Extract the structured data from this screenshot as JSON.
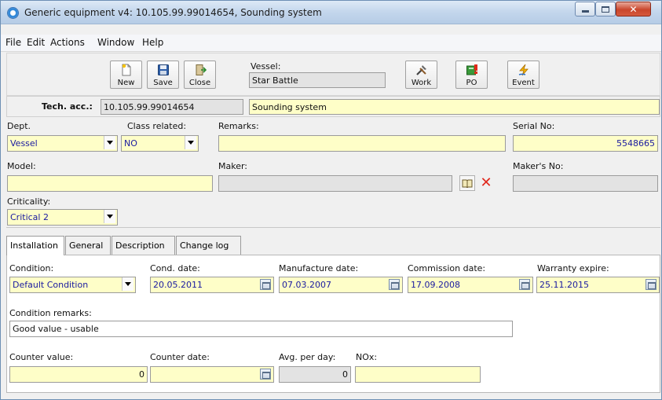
{
  "window": {
    "title": "Generic equipment v4: 10.105.99.99014654, Sounding system",
    "min_icon": "minimize-icon",
    "max_icon": "maximize-icon",
    "close_icon": "close-icon"
  },
  "menu": {
    "items": [
      "File",
      "Edit",
      "Actions",
      "Window",
      "Help"
    ]
  },
  "toolbar": {
    "new_label": "New",
    "save_label": "Save",
    "close_label": "Close",
    "vessel_label": "Vessel:",
    "vessel_value": "Star Battle",
    "work_label": "Work",
    "po_label": "PO",
    "event_label": "Event"
  },
  "header": {
    "tech_acc_label": "Tech. acc.:",
    "tech_acc_value": "10.105.99.99014654",
    "name_value": "Sounding system"
  },
  "details": {
    "dept_label": "Dept.",
    "dept_value": "Vessel",
    "class_related_label": "Class related:",
    "class_related_value": "NO",
    "remarks_label": "Remarks:",
    "remarks_value": "",
    "serial_no_label": "Serial No:",
    "serial_no_value": "5548665",
    "model_label": "Model:",
    "model_value": "",
    "maker_label": "Maker:",
    "maker_value": "",
    "makers_no_label": "Maker's No:",
    "makers_no_value": "",
    "criticality_label": "Criticality:",
    "criticality_value": "Critical 2"
  },
  "tabs": {
    "items": [
      "Installation",
      "General",
      "Description",
      "Change log"
    ],
    "active": "Installation"
  },
  "installation": {
    "condition_label": "Condition:",
    "condition_value": "Default Condition",
    "cond_date_label": "Cond. date:",
    "cond_date_value": "20.05.2011",
    "manufacture_date_label": "Manufacture date:",
    "manufacture_date_value": "07.03.2007",
    "commission_date_label": "Commission date:",
    "commission_date_value": "17.09.2008",
    "warranty_expire_label": "Warranty expire:",
    "warranty_expire_value": "25.11.2015",
    "condition_remarks_label": "Condition remarks:",
    "condition_remarks_value": "Good value - usable",
    "counter_value_label": "Counter value:",
    "counter_value_value": "0",
    "counter_date_label": "Counter date:",
    "counter_date_value": "",
    "avg_per_day_label": "Avg. per day:",
    "avg_per_day_value": "0",
    "nox_label": "NOx:",
    "nox_value": ""
  },
  "colors": {
    "required_field": "#fefec8",
    "readonly_field": "#e3e3e3",
    "value_text": "#1a1aa0",
    "titlebar": "#c3d6ec"
  }
}
